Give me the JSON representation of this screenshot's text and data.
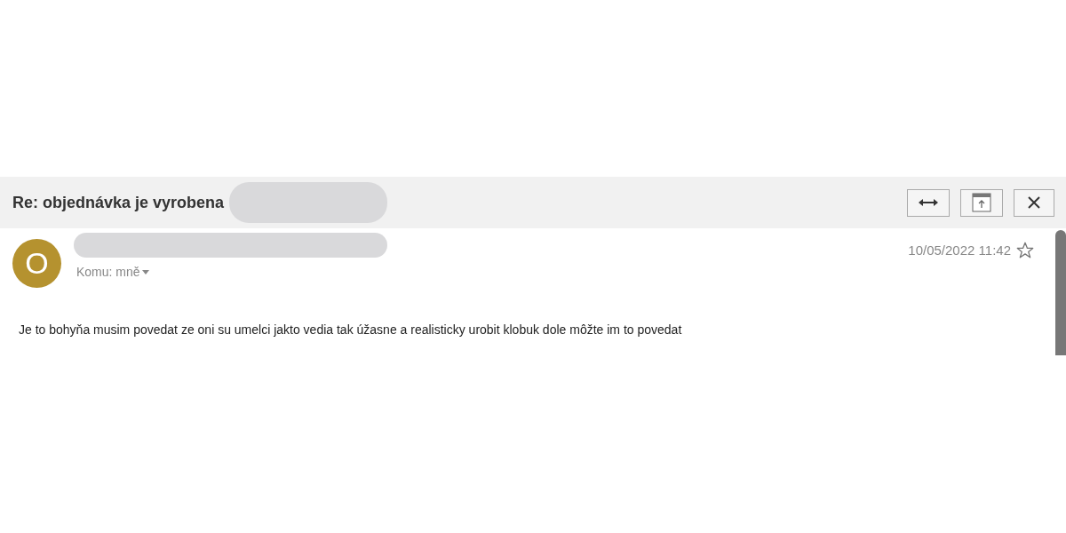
{
  "message": {
    "subject": "Re: objednávka je vyrobena",
    "toolbar": [
      {
        "kind": "expand"
      },
      {
        "kind": "popout"
      },
      {
        "kind": "close"
      }
    ],
    "avatar": {
      "letter": "O",
      "color": "#b5922f"
    },
    "recipient": "Komu: mně",
    "date": "10/05/2022 11:42",
    "starred": false,
    "body": "Je to bohyňa musim povedat ze oni su umelci jakto vedia tak úžasne a realisticky urobit klobuk dole môžte im to povedat"
  }
}
